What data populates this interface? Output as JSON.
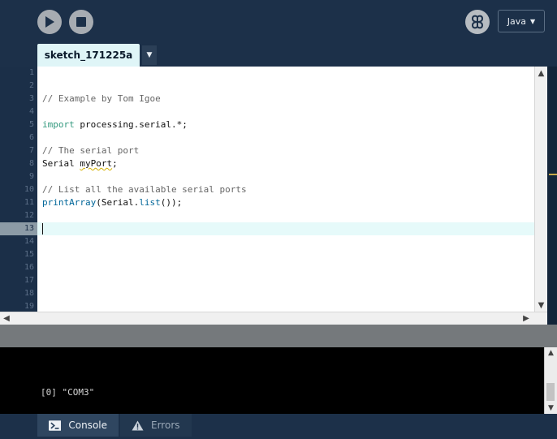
{
  "toolbar": {
    "mode_label": "Java",
    "mode_caret": "▼"
  },
  "tabs": {
    "active_label": "sketch_171225a",
    "menu_glyph": "▼"
  },
  "code": {
    "line_numbers": [
      "1",
      "2",
      "3",
      "4",
      "5",
      "6",
      "7",
      "8",
      "9",
      "10",
      "11",
      "12",
      "13",
      "14",
      "15",
      "16",
      "17",
      "18",
      "19"
    ],
    "current_line": 13,
    "l3_comment": "// Example by Tom Igoe",
    "l5_keyword": "import",
    "l5_rest": " processing.serial.*;",
    "l7_comment": "// The serial port",
    "l8_type": "Serial ",
    "l8_var": "myPort",
    "l8_end": ";",
    "l10_comment": "// List all the available serial ports",
    "l11_fn1": "printArray",
    "l11_mid": "(Serial.",
    "l11_fn2": "list",
    "l11_end": "());"
  },
  "console": {
    "output": "[0] \"COM3\""
  },
  "footer": {
    "console_label": "Console",
    "errors_label": "Errors"
  },
  "colors": {
    "background": "#14253a",
    "toolbar": "#1c3049",
    "active_tab": "#dff5f7",
    "keyword": "#33997e",
    "function": "#006699",
    "comment": "#666666"
  }
}
